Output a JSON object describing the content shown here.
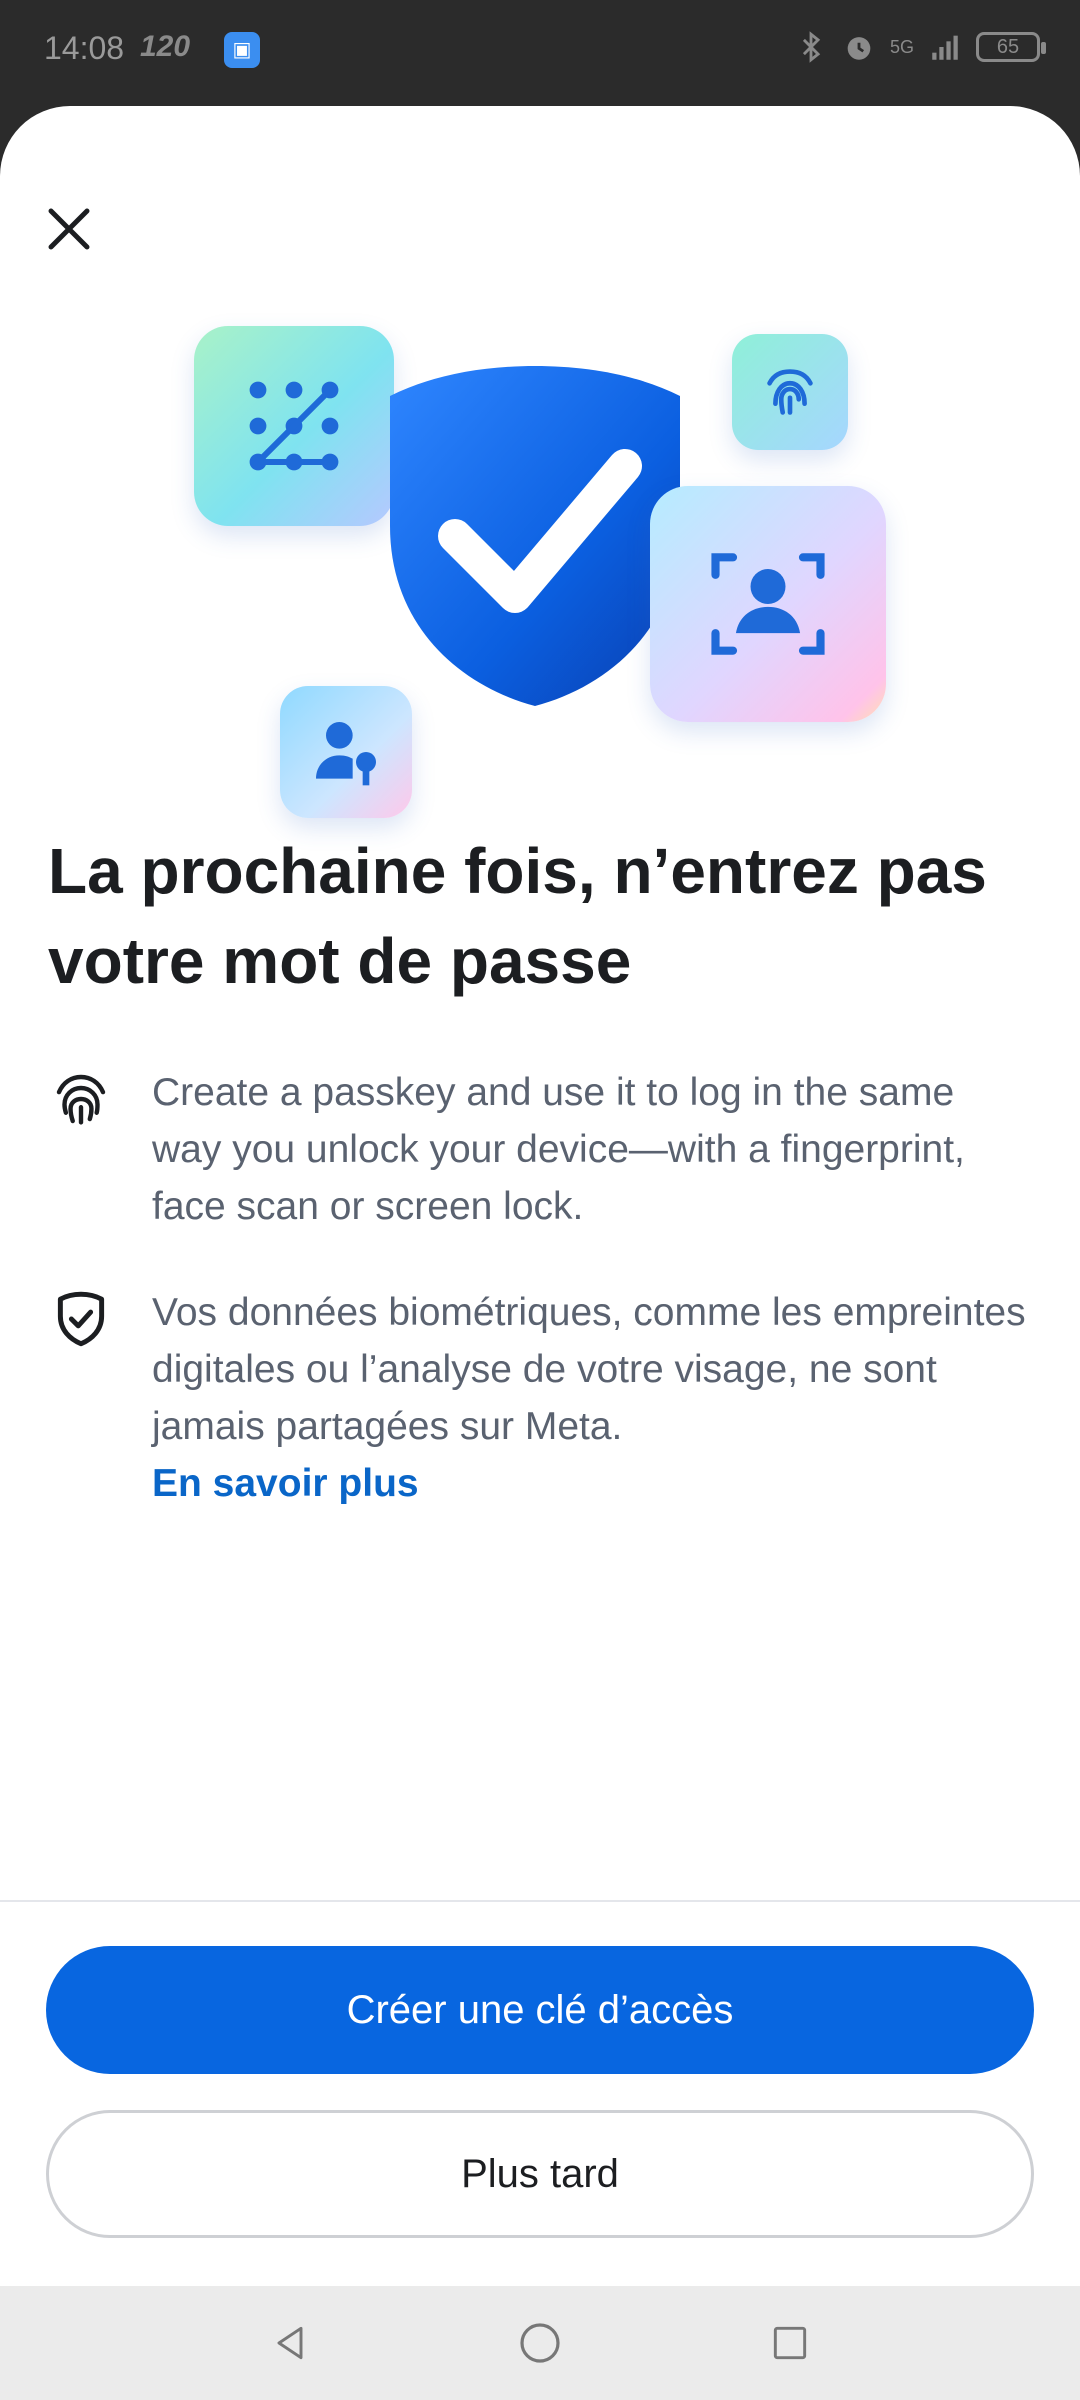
{
  "status_bar": {
    "time": "14:08",
    "refresh_rate": "120",
    "battery": "65",
    "network": "5G"
  },
  "dialog": {
    "title": "La prochaine fois, n’entrez pas votre mot de passe",
    "items": [
      {
        "icon": "fingerprint-icon",
        "text": "Create a passkey and use it to log in the same way you unlock your device—with a fingerprint, face scan or screen lock."
      },
      {
        "icon": "shield-check-icon",
        "text": "Vos données biométriques, comme les empreintes digitales ou l’analyse de votre visage, ne sont jamais partagées sur Meta.",
        "link": "En savoir plus"
      }
    ],
    "primary_button": "Créer une clé d’accès",
    "secondary_button": "Plus tard"
  },
  "colors": {
    "primary": "#0866e0",
    "link": "#0a66c8",
    "title_text": "#1c1e21",
    "body_text": "#5a6270"
  }
}
